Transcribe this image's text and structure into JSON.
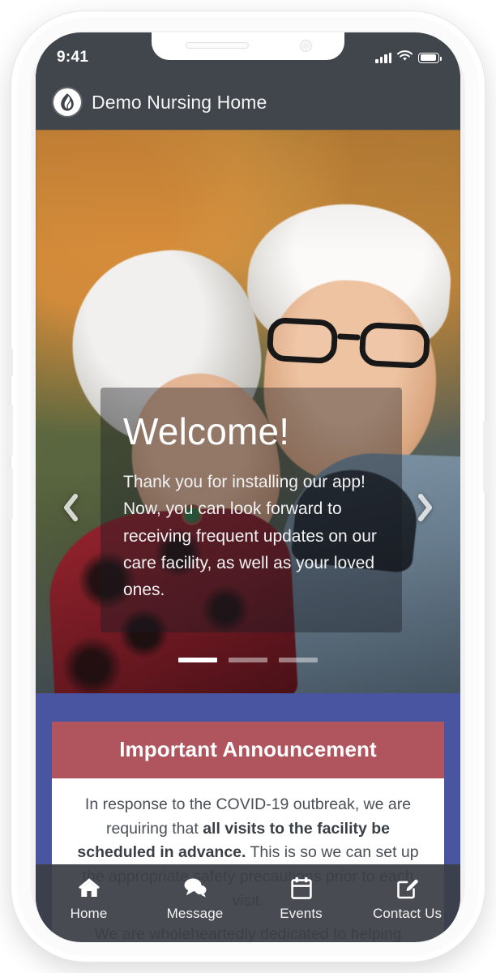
{
  "status_bar": {
    "time": "9:41",
    "signal_icon": "signal-bars-icon",
    "wifi_icon": "wifi-icon",
    "battery_icon": "battery-full-icon"
  },
  "app_header": {
    "logo_icon": "flame-logo-icon",
    "title": "Demo Nursing Home"
  },
  "hero": {
    "prev_icon": "chevron-left-icon",
    "next_icon": "chevron-right-icon",
    "slide": {
      "heading": "Welcome!",
      "body": "Thank you for installing our app! Now, you can look forward to receiving frequent updates on our care facility, as well as your loved ones."
    },
    "dots": [
      {
        "label": "slide-1",
        "active": true
      },
      {
        "label": "slide-2",
        "active": false
      },
      {
        "label": "slide-3",
        "active": false
      }
    ]
  },
  "announcement": {
    "heading": "Important Announcement",
    "body_part_1": "In response to the COVID-19 outbreak, we are requiring that ",
    "body_bold": "all visits to the facility be scheduled in advance.",
    "body_part_2": " This is so we can set up the appropriate safety precautions prior to each visit.",
    "body_part_3": "We are wholeheartedly dedicated to helping"
  },
  "tab_bar": {
    "items": [
      {
        "label": "Home",
        "icon": "home-icon"
      },
      {
        "label": "Message",
        "icon": "chat-bubbles-icon"
      },
      {
        "label": "Events",
        "icon": "calendar-icon"
      },
      {
        "label": "Contact Us",
        "icon": "compose-pencil-icon"
      }
    ]
  },
  "colors": {
    "header_dark": "#41454c",
    "band_blue": "#4a55a2",
    "announcement_red": "#b0545e",
    "card_white": "#ffffff",
    "tabbar_dark": "#3a3e45"
  }
}
